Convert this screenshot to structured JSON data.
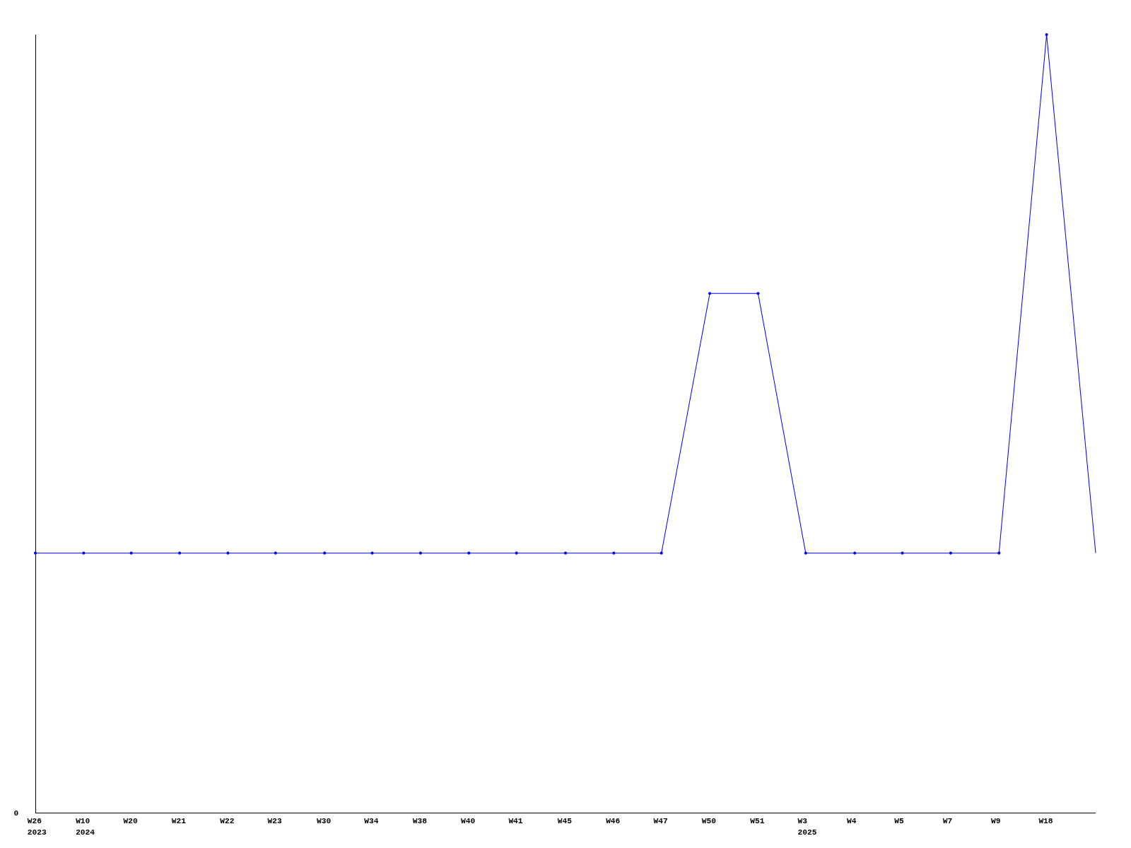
{
  "chart": {
    "y_tick": "0",
    "x_labels": [
      {
        "week": "W26",
        "year": "2023"
      },
      {
        "week": "W10",
        "year": "2024"
      },
      {
        "week": "W20"
      },
      {
        "week": "W21"
      },
      {
        "week": "W22"
      },
      {
        "week": "W23"
      },
      {
        "week": "W30"
      },
      {
        "week": "W34"
      },
      {
        "week": "W38"
      },
      {
        "week": "W40"
      },
      {
        "week": "W41"
      },
      {
        "week": "W45"
      },
      {
        "week": "W46"
      },
      {
        "week": "W47"
      },
      {
        "week": "W50"
      },
      {
        "week": "W51"
      },
      {
        "week": "W3",
        "year": "2025"
      },
      {
        "week": "W4"
      },
      {
        "week": "W5"
      },
      {
        "week": "W7"
      },
      {
        "week": "W9"
      },
      {
        "week": "W18"
      }
    ]
  }
}
